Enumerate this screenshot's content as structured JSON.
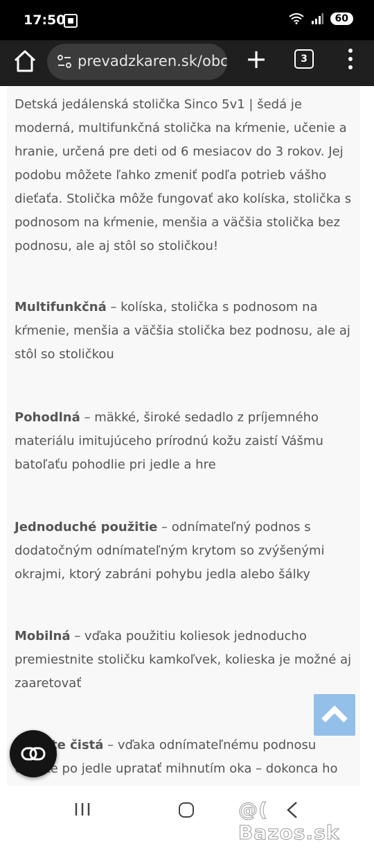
{
  "status_bar": {
    "time": "17:50",
    "battery": "60",
    "icons": [
      "cast-icon",
      "wifi-icon",
      "signal-icon"
    ]
  },
  "browser": {
    "url": "prevadzkaren.sk/obc",
    "tab_count": "3",
    "icons": [
      "home-icon",
      "site-info-icon",
      "new-tab-icon",
      "tabs-icon",
      "menu-icon"
    ]
  },
  "article": {
    "intro": "Detská jedálenská stolička Sinco 5v1 | šedá je moderná, multifunkčná stolička na kŕmenie, učenie a hranie, určená pre deti od 6 mesiacov do 3 rokov. Jej podobu môžete ľahko zmeniť podľa potrieb vášho dieťaťa. Stolička môže fungovať ako kolíska, stolička s podnosom na kŕmenie, menšia a väčšia stolička bez podnosu, ale aj stôl so stoličkou!",
    "features": [
      {
        "title": " Multifunkčná",
        "text": " – kolíska, stolička s podnosom na kŕmenie, menšia a väčšia stolička bez podnosu, ale aj stôl so stoličkou"
      },
      {
        "title": "Pohodlná",
        "text": " – mäkké, široké sedadlo z príjemného materiálu imitujúceho prírodnú kožu zaistí Vášmu batoľaťu pohodlie pri jedle a hre"
      },
      {
        "title": "Jednoduché použitie",
        "text": " – odnímateľný podnos s dodatočným odnímateľným krytom so zvýšenými okrajmi, ktorý zabráni pohybu jedla alebo šálky"
      },
      {
        "title": "Mobilná",
        "text": " – vďaka použitiu koliesok jednoducho premiestnite stoličku kamkoľvek, kolieska je možné aj zaaretovať"
      },
      {
        "title": "Udržíte čistá",
        "text": " – vďaka odnímateľnému podnosu udržíte po jedle upratať mihnutím oka – dokonca ho"
      }
    ]
  },
  "overlays": {
    "scroll_top": "scroll-to-top-button",
    "fab": "link-icon"
  },
  "navigation_bar": {
    "icons": [
      "recent-apps-icon",
      "home-icon",
      "back-icon"
    ]
  },
  "watermark": "@( Bazos.sk"
}
